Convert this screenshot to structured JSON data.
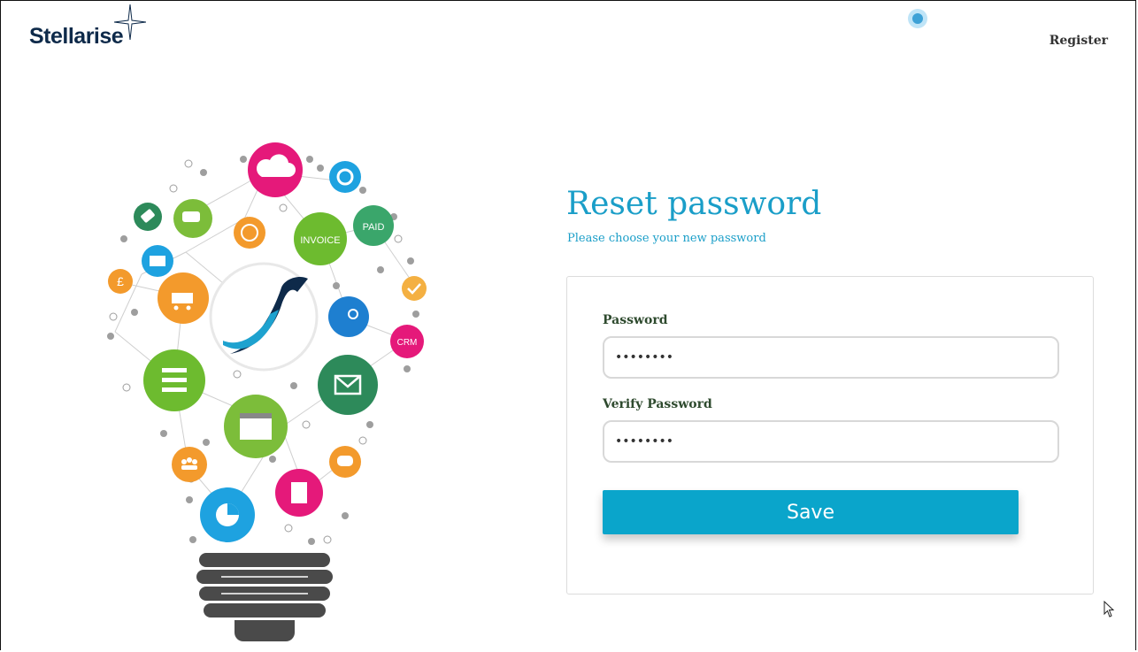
{
  "brand": {
    "name": "Stellarise"
  },
  "header": {
    "register_label": "Register"
  },
  "reset": {
    "title": "Reset password",
    "subtitle": "Please choose your new password"
  },
  "form": {
    "password_label": "Password",
    "password_value": "••••••••",
    "verify_label": "Verify Password",
    "verify_value": "••••••••",
    "save_label": "Save"
  },
  "illustration": {
    "badges": [
      "INVOICE",
      "PAID",
      "CRM"
    ]
  },
  "colors": {
    "accent": "#1a9ec8",
    "button": "#0aa5cb",
    "logo": "#0e2a4a"
  }
}
